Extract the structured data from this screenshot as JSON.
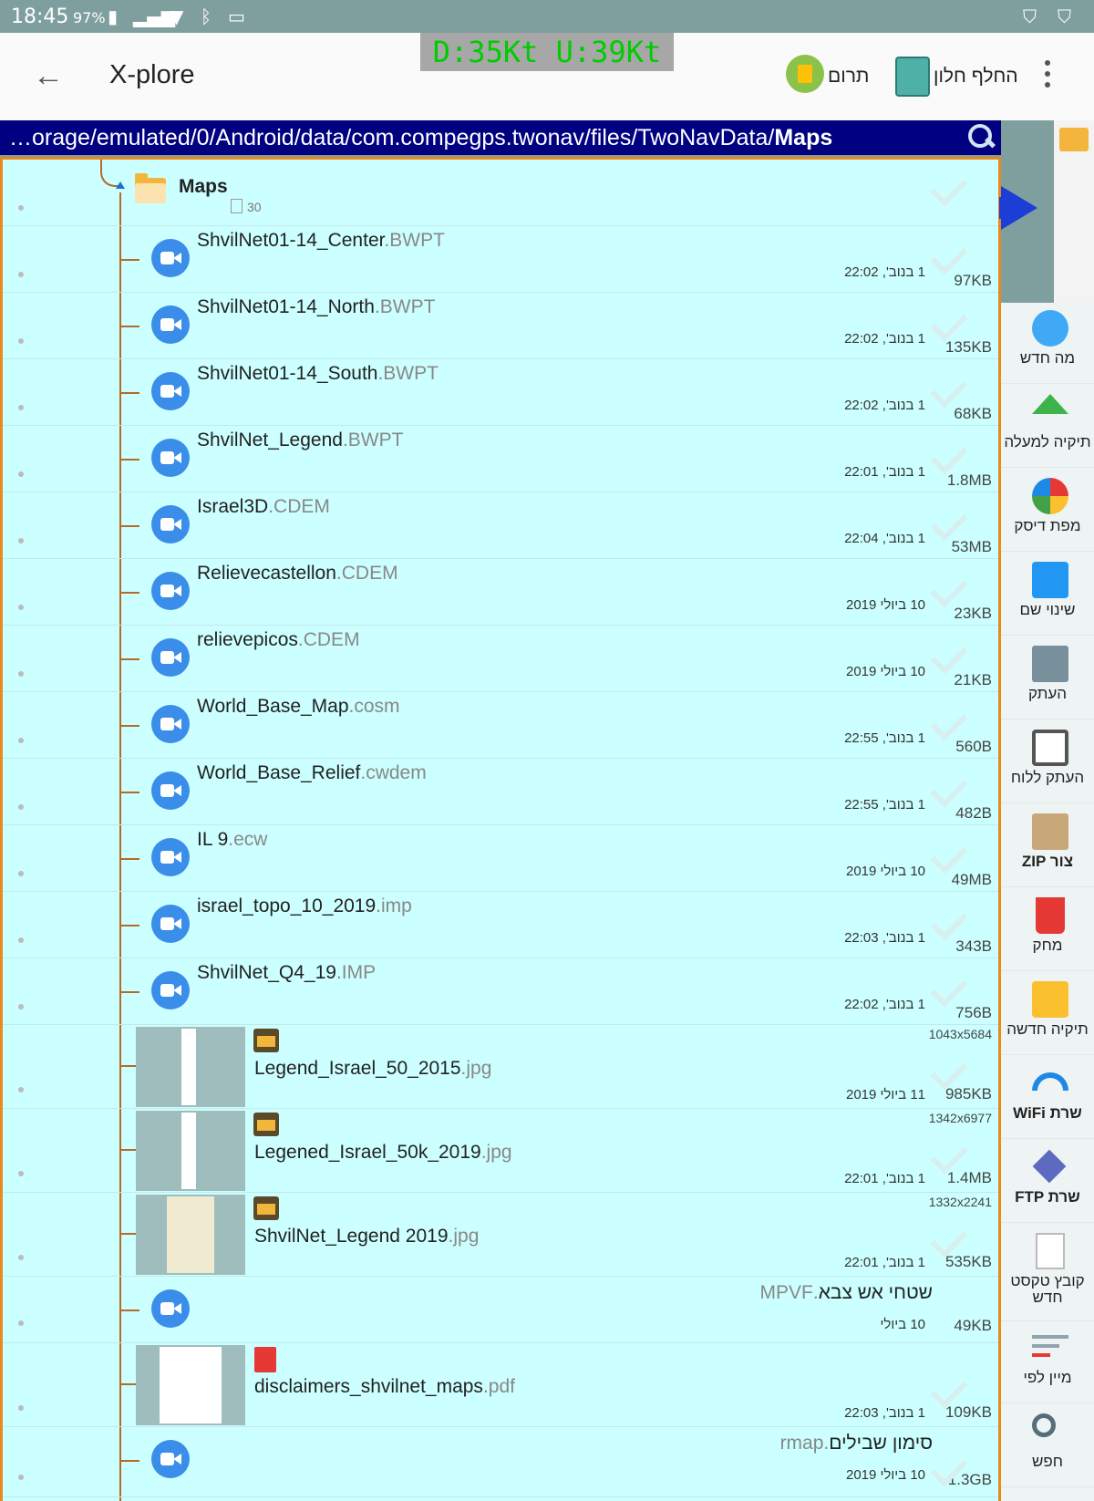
{
  "status_bar": {
    "time": "18:45",
    "battery": "97%"
  },
  "app_bar": {
    "title": "X-plore",
    "speed": "D:35Kt U:39Kt",
    "donate_label": "תרום",
    "switch_label": "החלף חלון"
  },
  "path": {
    "prefix": "…orage/emulated/0/Android/data/com.compegps.twonav/files/TwoNavData/",
    "current": "Maps"
  },
  "folder": {
    "name": "Maps",
    "count": "30"
  },
  "files": [
    {
      "name": "ShvilNet01-14_Center",
      "ext": ".BWPT",
      "date": "1 בנוב', 22:02",
      "size": "97KB"
    },
    {
      "name": "ShvilNet01-14_North",
      "ext": ".BWPT",
      "date": "1 בנוב', 22:02",
      "size": "135KB"
    },
    {
      "name": "ShvilNet01-14_South",
      "ext": ".BWPT",
      "date": "1 בנוב', 22:02",
      "size": "68KB"
    },
    {
      "name": "ShvilNet_Legend",
      "ext": ".BWPT",
      "date": "1 בנוב', 22:01",
      "size": "1.8MB"
    },
    {
      "name": "Israel3D",
      "ext": ".CDEM",
      "date": "1 בנוב', 22:04",
      "size": "53MB"
    },
    {
      "name": "Relievecastellon",
      "ext": ".CDEM",
      "date": "10 ביולי 2019",
      "size": "23KB"
    },
    {
      "name": "relievepicos",
      "ext": ".CDEM",
      "date": "10 ביולי 2019",
      "size": "21KB"
    },
    {
      "name": "World_Base_Map",
      "ext": ".cosm",
      "date": "1 בנוב', 22:55",
      "size": "560B"
    },
    {
      "name": "World_Base_Relief",
      "ext": ".cwdem",
      "date": "1 בנוב', 22:55",
      "size": "482B"
    },
    {
      "name": "IL 9",
      "ext": ".ecw",
      "date": "10 ביולי 2019",
      "size": "49MB"
    },
    {
      "name": "israel_topo_10_2019",
      "ext": ".imp",
      "date": "1 בנוב', 22:03",
      "size": "343B"
    },
    {
      "name": "ShvilNet_Q4_19",
      "ext": ".IMP",
      "date": "1 בנוב', 22:02",
      "size": "756B"
    }
  ],
  "images": [
    {
      "name": "Legend_Israel_50_2015",
      "ext": ".jpg",
      "dims": "1043x5684",
      "date": "11 ביולי 2019",
      "size": "985KB"
    },
    {
      "name": "Legened_Israel_50k_2019",
      "ext": ".jpg",
      "dims": "1342x6977",
      "date": "1 בנוב', 22:01",
      "size": "1.4MB"
    },
    {
      "name": "ShvilNet_Legend 2019",
      "ext": ".jpg",
      "dims": "1332x2241",
      "date": "1 בנוב', 22:01",
      "size": "535KB"
    }
  ],
  "extra": [
    {
      "name": "שטחי אש צבא",
      "ext": ".MPVF",
      "date": "10 ביולי",
      "size": "49KB"
    },
    {
      "name": "disclaimers_shvilnet_maps",
      "ext": ".pdf",
      "date": "1 בנוב', 22:03",
      "size": "109KB"
    },
    {
      "name": "סימון שבילים",
      "ext": ".rmap",
      "date": "10 ביולי 2019",
      "size": "1.3GB"
    }
  ],
  "toolbar": {
    "whats_new": "מה חדש",
    "up_folder": "תיקיה למעלה",
    "disk_map": "מפת דיסק",
    "rename": "שינוי שם",
    "copy": "העתק",
    "copy_clipboard": "העתק ללוח",
    "zip": "ZIP צור",
    "delete": "מחק",
    "new_folder": "תיקיה חדשה",
    "wifi": "WiFi שרת",
    "ftp": "FTP שרת",
    "new_text_line1": "קובץ טקסט",
    "new_text_line2": "חדש",
    "sort": "מיין לפי",
    "search": "חפש"
  },
  "colors": {
    "path_bar": "#000080",
    "panel": "#ccffff",
    "accent": "#e8891e",
    "speed": "#00cc00"
  }
}
